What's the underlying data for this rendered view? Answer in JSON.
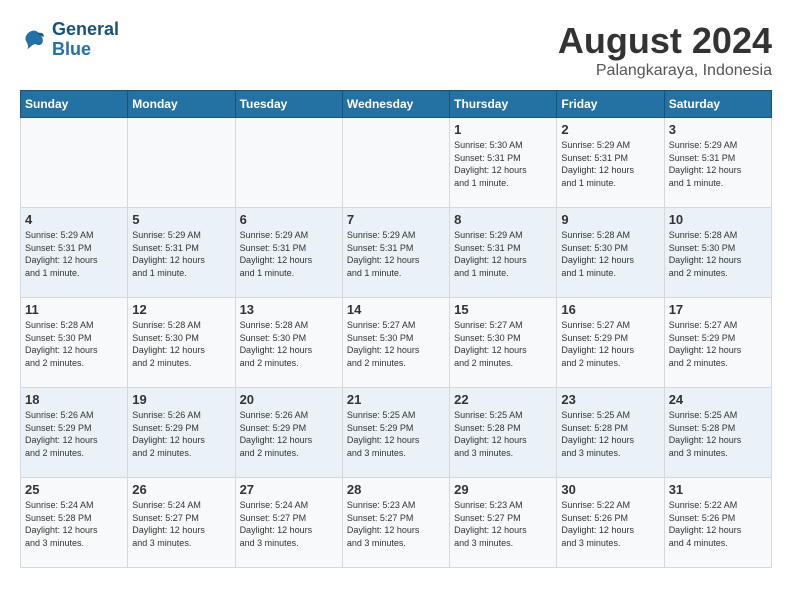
{
  "logo": {
    "line1": "General",
    "line2": "Blue"
  },
  "title": "August 2024",
  "location": "Palangkaraya, Indonesia",
  "days_of_week": [
    "Sunday",
    "Monday",
    "Tuesday",
    "Wednesday",
    "Thursday",
    "Friday",
    "Saturday"
  ],
  "weeks": [
    [
      {
        "day": "",
        "text": ""
      },
      {
        "day": "",
        "text": ""
      },
      {
        "day": "",
        "text": ""
      },
      {
        "day": "",
        "text": ""
      },
      {
        "day": "1",
        "text": "Sunrise: 5:30 AM\nSunset: 5:31 PM\nDaylight: 12 hours\nand 1 minute."
      },
      {
        "day": "2",
        "text": "Sunrise: 5:29 AM\nSunset: 5:31 PM\nDaylight: 12 hours\nand 1 minute."
      },
      {
        "day": "3",
        "text": "Sunrise: 5:29 AM\nSunset: 5:31 PM\nDaylight: 12 hours\nand 1 minute."
      }
    ],
    [
      {
        "day": "4",
        "text": "Sunrise: 5:29 AM\nSunset: 5:31 PM\nDaylight: 12 hours\nand 1 minute."
      },
      {
        "day": "5",
        "text": "Sunrise: 5:29 AM\nSunset: 5:31 PM\nDaylight: 12 hours\nand 1 minute."
      },
      {
        "day": "6",
        "text": "Sunrise: 5:29 AM\nSunset: 5:31 PM\nDaylight: 12 hours\nand 1 minute."
      },
      {
        "day": "7",
        "text": "Sunrise: 5:29 AM\nSunset: 5:31 PM\nDaylight: 12 hours\nand 1 minute."
      },
      {
        "day": "8",
        "text": "Sunrise: 5:29 AM\nSunset: 5:31 PM\nDaylight: 12 hours\nand 1 minute."
      },
      {
        "day": "9",
        "text": "Sunrise: 5:28 AM\nSunset: 5:30 PM\nDaylight: 12 hours\nand 1 minute."
      },
      {
        "day": "10",
        "text": "Sunrise: 5:28 AM\nSunset: 5:30 PM\nDaylight: 12 hours\nand 2 minutes."
      }
    ],
    [
      {
        "day": "11",
        "text": "Sunrise: 5:28 AM\nSunset: 5:30 PM\nDaylight: 12 hours\nand 2 minutes."
      },
      {
        "day": "12",
        "text": "Sunrise: 5:28 AM\nSunset: 5:30 PM\nDaylight: 12 hours\nand 2 minutes."
      },
      {
        "day": "13",
        "text": "Sunrise: 5:28 AM\nSunset: 5:30 PM\nDaylight: 12 hours\nand 2 minutes."
      },
      {
        "day": "14",
        "text": "Sunrise: 5:27 AM\nSunset: 5:30 PM\nDaylight: 12 hours\nand 2 minutes."
      },
      {
        "day": "15",
        "text": "Sunrise: 5:27 AM\nSunset: 5:30 PM\nDaylight: 12 hours\nand 2 minutes."
      },
      {
        "day": "16",
        "text": "Sunrise: 5:27 AM\nSunset: 5:29 PM\nDaylight: 12 hours\nand 2 minutes."
      },
      {
        "day": "17",
        "text": "Sunrise: 5:27 AM\nSunset: 5:29 PM\nDaylight: 12 hours\nand 2 minutes."
      }
    ],
    [
      {
        "day": "18",
        "text": "Sunrise: 5:26 AM\nSunset: 5:29 PM\nDaylight: 12 hours\nand 2 minutes."
      },
      {
        "day": "19",
        "text": "Sunrise: 5:26 AM\nSunset: 5:29 PM\nDaylight: 12 hours\nand 2 minutes."
      },
      {
        "day": "20",
        "text": "Sunrise: 5:26 AM\nSunset: 5:29 PM\nDaylight: 12 hours\nand 2 minutes."
      },
      {
        "day": "21",
        "text": "Sunrise: 5:25 AM\nSunset: 5:29 PM\nDaylight: 12 hours\nand 3 minutes."
      },
      {
        "day": "22",
        "text": "Sunrise: 5:25 AM\nSunset: 5:28 PM\nDaylight: 12 hours\nand 3 minutes."
      },
      {
        "day": "23",
        "text": "Sunrise: 5:25 AM\nSunset: 5:28 PM\nDaylight: 12 hours\nand 3 minutes."
      },
      {
        "day": "24",
        "text": "Sunrise: 5:25 AM\nSunset: 5:28 PM\nDaylight: 12 hours\nand 3 minutes."
      }
    ],
    [
      {
        "day": "25",
        "text": "Sunrise: 5:24 AM\nSunset: 5:28 PM\nDaylight: 12 hours\nand 3 minutes."
      },
      {
        "day": "26",
        "text": "Sunrise: 5:24 AM\nSunset: 5:27 PM\nDaylight: 12 hours\nand 3 minutes."
      },
      {
        "day": "27",
        "text": "Sunrise: 5:24 AM\nSunset: 5:27 PM\nDaylight: 12 hours\nand 3 minutes."
      },
      {
        "day": "28",
        "text": "Sunrise: 5:23 AM\nSunset: 5:27 PM\nDaylight: 12 hours\nand 3 minutes."
      },
      {
        "day": "29",
        "text": "Sunrise: 5:23 AM\nSunset: 5:27 PM\nDaylight: 12 hours\nand 3 minutes."
      },
      {
        "day": "30",
        "text": "Sunrise: 5:22 AM\nSunset: 5:26 PM\nDaylight: 12 hours\nand 3 minutes."
      },
      {
        "day": "31",
        "text": "Sunrise: 5:22 AM\nSunset: 5:26 PM\nDaylight: 12 hours\nand 4 minutes."
      }
    ]
  ]
}
